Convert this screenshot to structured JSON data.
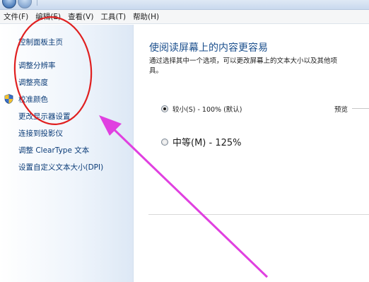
{
  "menubar": {
    "items": [
      "文件(F)",
      "编辑(E)",
      "查看(V)",
      "工具(T)",
      "帮助(H)"
    ]
  },
  "sidebar": {
    "items": [
      {
        "label": "控制面板主页"
      },
      {
        "label": "调整分辨率"
      },
      {
        "label": "调整亮度"
      },
      {
        "label": "校准颜色"
      },
      {
        "label": "更改显示器设置"
      },
      {
        "label": "连接到投影仪"
      },
      {
        "label": "调整 ClearType 文本"
      },
      {
        "label": "设置自定义文本大小(DPI)"
      }
    ]
  },
  "main": {
    "title": "使阅读屏幕上的内容更容易",
    "description_line1": "通过选择其中一个选项，可以更改屏幕上的文本大小以及其他项",
    "description_line2": "具。",
    "options": [
      {
        "label": "较小(S) - 100% (默认)",
        "checked": true
      },
      {
        "label": "中等(M) - 125%",
        "checked": false
      }
    ],
    "preview_label": "预览"
  },
  "colors": {
    "title": "#1a4e8c",
    "link": "#0b3c78",
    "annotation_circle": "#e02020",
    "annotation_arrow": "#e040e0"
  }
}
